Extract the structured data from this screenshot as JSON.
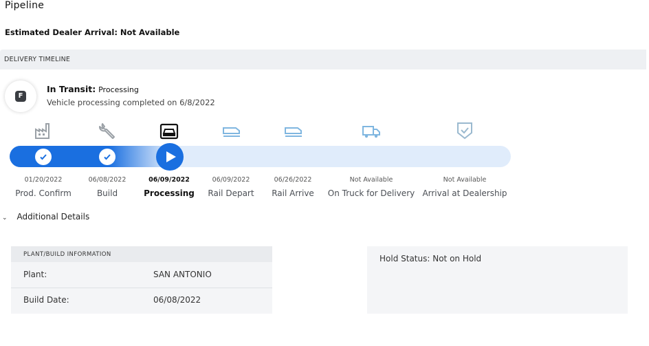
{
  "page": {
    "title": "Pipeline"
  },
  "eta": {
    "text": "Estimated Dealer Arrival: Not Available"
  },
  "timeline": {
    "header": "DELIVERY TIMELINE",
    "badge_letter": "F",
    "status_main": "In Transit:",
    "status_sub": "Processing",
    "status_desc": "Vehicle processing completed on 6/8/2022",
    "progress_percent": 32,
    "current_step_index": 2,
    "steps": [
      {
        "date": "01/20/2022",
        "label": "Prod. Confirm",
        "icon": "factory-icon",
        "state": "done"
      },
      {
        "date": "06/08/2022",
        "label": "Build",
        "icon": "wrench-icon",
        "state": "done"
      },
      {
        "date": "06/09/2022",
        "label": "Processing",
        "icon": "car-processing-icon",
        "state": "current"
      },
      {
        "date": "06/09/2022",
        "label": "Rail Depart",
        "icon": "rail-depart-icon",
        "state": "pending"
      },
      {
        "date": "06/26/2022",
        "label": "Rail Arrive",
        "icon": "rail-arrive-icon",
        "state": "pending"
      },
      {
        "date": "Not Available",
        "label": "On Truck for Delivery",
        "icon": "truck-icon",
        "state": "pending"
      },
      {
        "date": "Not Available",
        "label": "Arrival at Dealership",
        "icon": "shield-check-icon",
        "state": "pending"
      }
    ]
  },
  "additional": {
    "toggle_label": "Additional Details",
    "plant_card": {
      "header": "PLANT/BUILD INFORMATION",
      "rows": [
        {
          "key": "Plant:",
          "value": "SAN ANTONIO"
        },
        {
          "key": "Build Date:",
          "value": "06/08/2022"
        }
      ]
    },
    "hold_status": "Hold Status: Not on Hold"
  },
  "colors": {
    "accent": "#1a6fe0",
    "track": "#e0ecfb",
    "done_icon": "#9aa0a6",
    "pending_icon": "#7fb6e0"
  }
}
